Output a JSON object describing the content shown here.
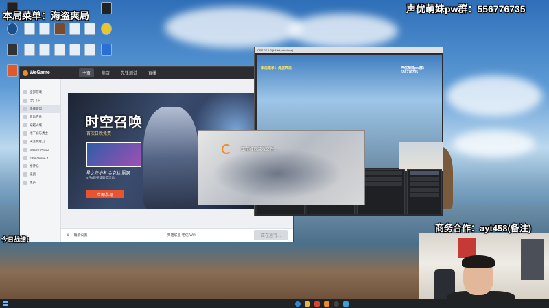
{
  "overlays": {
    "top_left": "本局菜单：海盗爽局",
    "top_right": "声优萌妹pw群：556776735",
    "business": "商务合作：ayt458(备注)",
    "today": "今日战绩："
  },
  "wegame": {
    "logo": "WeGame",
    "tabs": [
      "主页",
      "商店",
      "先锋测试",
      "直播"
    ],
    "sidebar_items": [
      "全部游戏",
      "QQ飞车",
      "英雄联盟",
      "命运方舟",
      "穿越火线",
      "地下城与勇士",
      "天涯明月刀",
      "NBA2K Online",
      "FIFA Online 4",
      "枪神纪",
      "逆战",
      "更多"
    ],
    "banner_title": "时空召唤",
    "banner_sub": "首次日晚免费",
    "card_title": "星之守护者 金克丝 厕洞",
    "card_sub": "4月8日英雄联盟活动",
    "join_button": "立即参与",
    "bottom_left": "辅助设置",
    "bottom_status": "英雄联盟  电信  Wifi",
    "launch_button": "正在运行..."
  },
  "loading": {
    "title": "正在检查游戏文件..."
  },
  "obs": {
    "title": "OBS 27.1.3 (64-bit, windows)",
    "overlay_left": "本局菜单：海盗爽局",
    "overlay_right": "声优萌妹pw群：556776735"
  },
  "desktop_icons": [
    "",
    "",
    "",
    "",
    "",
    "",
    "",
    "",
    "",
    "",
    "",
    "",
    "",
    "",
    "",
    "",
    "",
    ""
  ]
}
